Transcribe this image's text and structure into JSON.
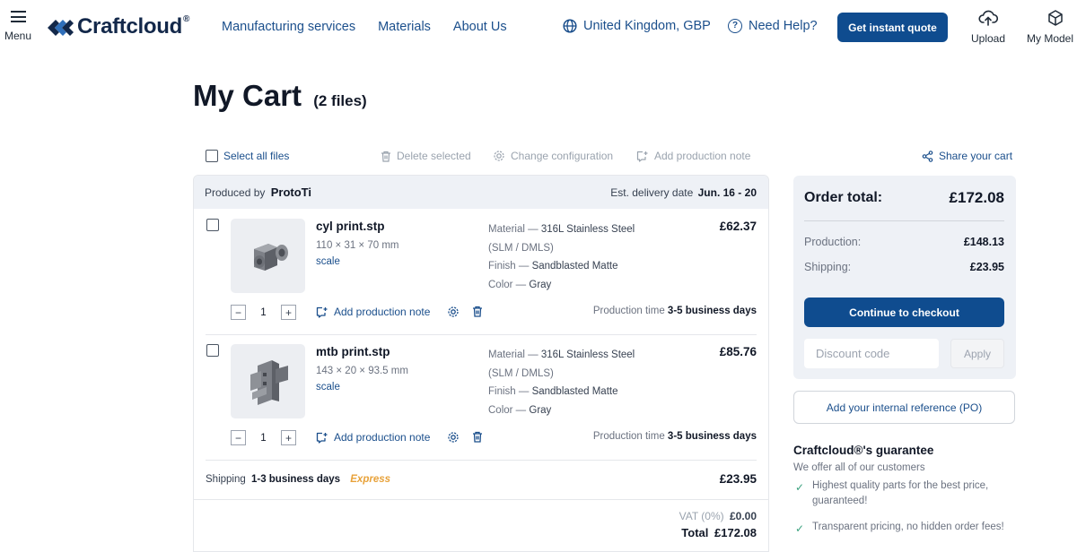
{
  "header": {
    "menu_label": "Menu",
    "logo_text": "Craftcloud",
    "logo_mark": "®",
    "nav": [
      "Manufacturing services",
      "Materials",
      "About Us"
    ],
    "region": "United Kingdom, GBP",
    "help": "Need Help?",
    "help_mark": "?",
    "quote_button": "Get instant quote",
    "upload_label": "Upload",
    "models_label": "My Model"
  },
  "page": {
    "title": "My Cart",
    "file_count": "(2 files)"
  },
  "toolbar": {
    "select_all": "Select all files",
    "delete_selected": "Delete selected",
    "change_configuration": "Change configuration",
    "add_production_note": "Add production note",
    "share_cart": "Share your cart"
  },
  "cart": {
    "produced_by_label": "Produced by",
    "producer": "ProtoTi",
    "delivery_label": "Est. delivery date",
    "delivery_dates": "Jun. 16 - 20",
    "items": [
      {
        "name": "cyl print.stp",
        "dimensions": "110 × 31 × 70 mm",
        "scale_link": "scale",
        "material_label": "Material —",
        "material_value": "316L Stainless Steel",
        "material_sub": "(SLM / DMLS)",
        "finish_label": "Finish —",
        "finish_value": "Sandblasted Matte",
        "color_label": "Color —",
        "color_value": "Gray",
        "price": "£62.37",
        "quantity": "1",
        "note_link": "Add production note",
        "production_label": "Production time",
        "production_time": "3-5 business days"
      },
      {
        "name": "mtb print.stp",
        "dimensions": "143 × 20 × 93.5 mm",
        "scale_link": "scale",
        "material_label": "Material —",
        "material_value": "316L Stainless Steel",
        "material_sub": "(SLM / DMLS)",
        "finish_label": "Finish —",
        "finish_value": "Sandblasted Matte",
        "color_label": "Color —",
        "color_value": "Gray",
        "price": "£85.76",
        "quantity": "1",
        "note_link": "Add production note",
        "production_label": "Production time",
        "production_time": "3-5 business days"
      }
    ],
    "shipping_label": "Shipping",
    "shipping_time": "1-3 business days",
    "shipping_type": "Express",
    "shipping_price": "£23.95",
    "vat_label": "VAT (0%)",
    "vat_value": "£0.00",
    "total_label": "Total",
    "total_value": "£172.08"
  },
  "summary": {
    "order_total_label": "Order total:",
    "order_total": "£172.08",
    "production_label": "Production:",
    "production_value": "£148.13",
    "shipping_label": "Shipping:",
    "shipping_value": "£23.95",
    "checkout_button": "Continue to checkout",
    "discount_placeholder": "Discount code",
    "apply_button": "Apply",
    "po_button": "Add your internal reference (PO)"
  },
  "guarantee": {
    "title": "Craftcloud®'s guarantee",
    "subtitle": "We offer all of our customers",
    "points": [
      "Highest quality parts for the best price, guaranteed!",
      "Transparent pricing, no hidden order fees!"
    ]
  },
  "colors": {
    "brand_navy": "#13284a",
    "primary_button": "#0f4c8f",
    "link_blue": "#1b4f8c",
    "panel_bg": "#eef1f6",
    "express_orange": "#e8a23a",
    "check_green": "#3aa17e"
  },
  "icons": [
    "menu-icon",
    "logo-icon",
    "globe-icon",
    "help-icon",
    "upload-icon",
    "cube-icon",
    "trash-icon",
    "gear-icon",
    "note-icon",
    "share-icon",
    "check-icon"
  ]
}
